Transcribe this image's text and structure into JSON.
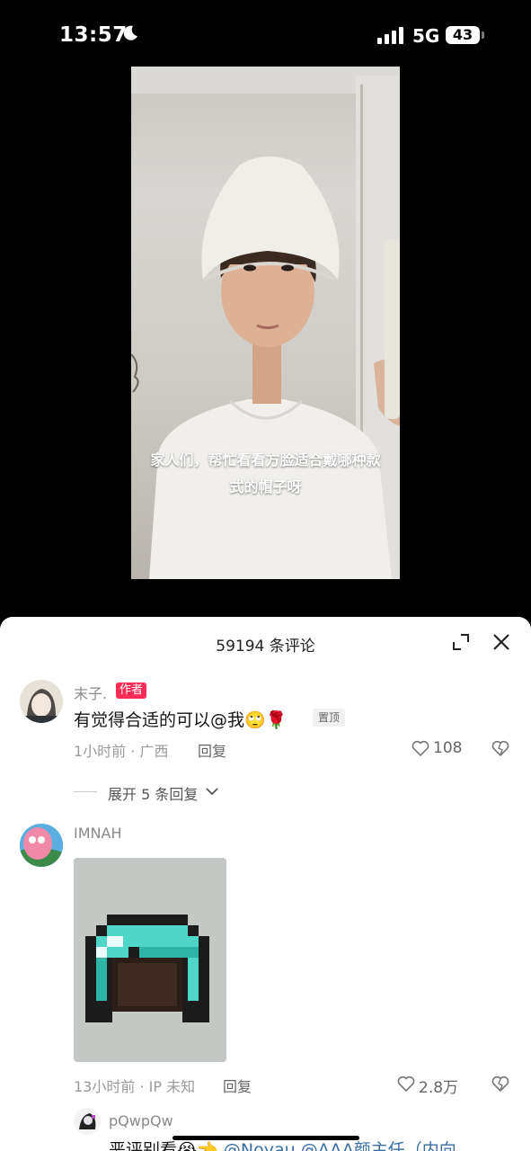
{
  "status_bar": {
    "time": "13:57",
    "network": "5G",
    "battery": "43"
  },
  "video": {
    "caption_line1": "家人们，帮忙看看方脸适合戴哪种款",
    "caption_line2": "式的帽子呀"
  },
  "comments_sheet": {
    "title": "59194 条评论",
    "comments": [
      {
        "username": "末子.",
        "author_badge": "作者",
        "text": "有觉得合适的可以@我🙄🌹",
        "pinned_label": "置顶",
        "time_location": "1小时前 · 广西",
        "reply_label": "回复",
        "likes": "108",
        "expand_replies": "展开 5 条回复"
      },
      {
        "username": "IMNAH",
        "time_location": "13小时前 · IP 未知",
        "reply_label": "回复",
        "likes": "2.8万"
      }
    ],
    "sub_reply": {
      "username": "pQwpQw",
      "text_start": "恶评别看😭👈",
      "mention1": "@Noyau",
      "mention2": "@AAA颜主任（内向"
    }
  },
  "colors": {
    "accent": "#fe2c55",
    "mention": "#3a6fa5",
    "diamond": "#4fd6c9"
  }
}
